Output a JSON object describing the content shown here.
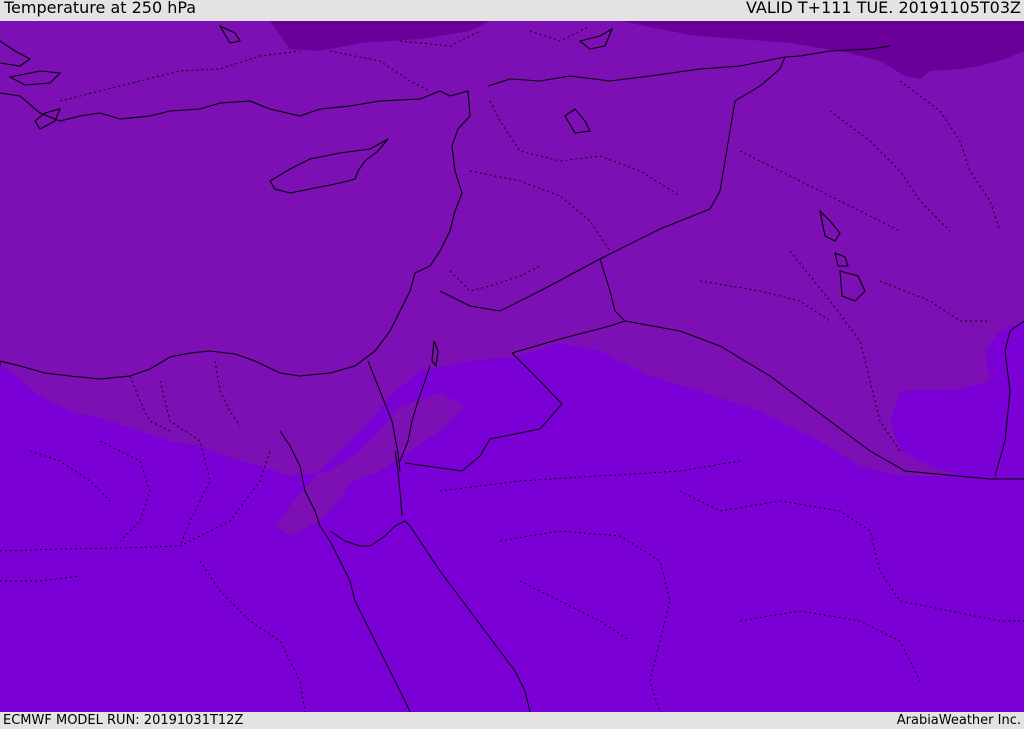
{
  "header": {
    "title": "Temperature at 250 hPa",
    "valid": "VALID T+111 TUE. 20191105T03Z"
  },
  "footer": {
    "model_run": "ECMWF MODEL RUN: 20191031T12Z",
    "credit": "ArabiaWeather Inc."
  },
  "map": {
    "field": "temperature",
    "level": "250 hPa",
    "colors": {
      "warm_band": "#7a00d6",
      "mid_band": "#7c10b4",
      "cold_band": "#6a0099",
      "coastline": "#000000",
      "borders": "#000000"
    }
  }
}
